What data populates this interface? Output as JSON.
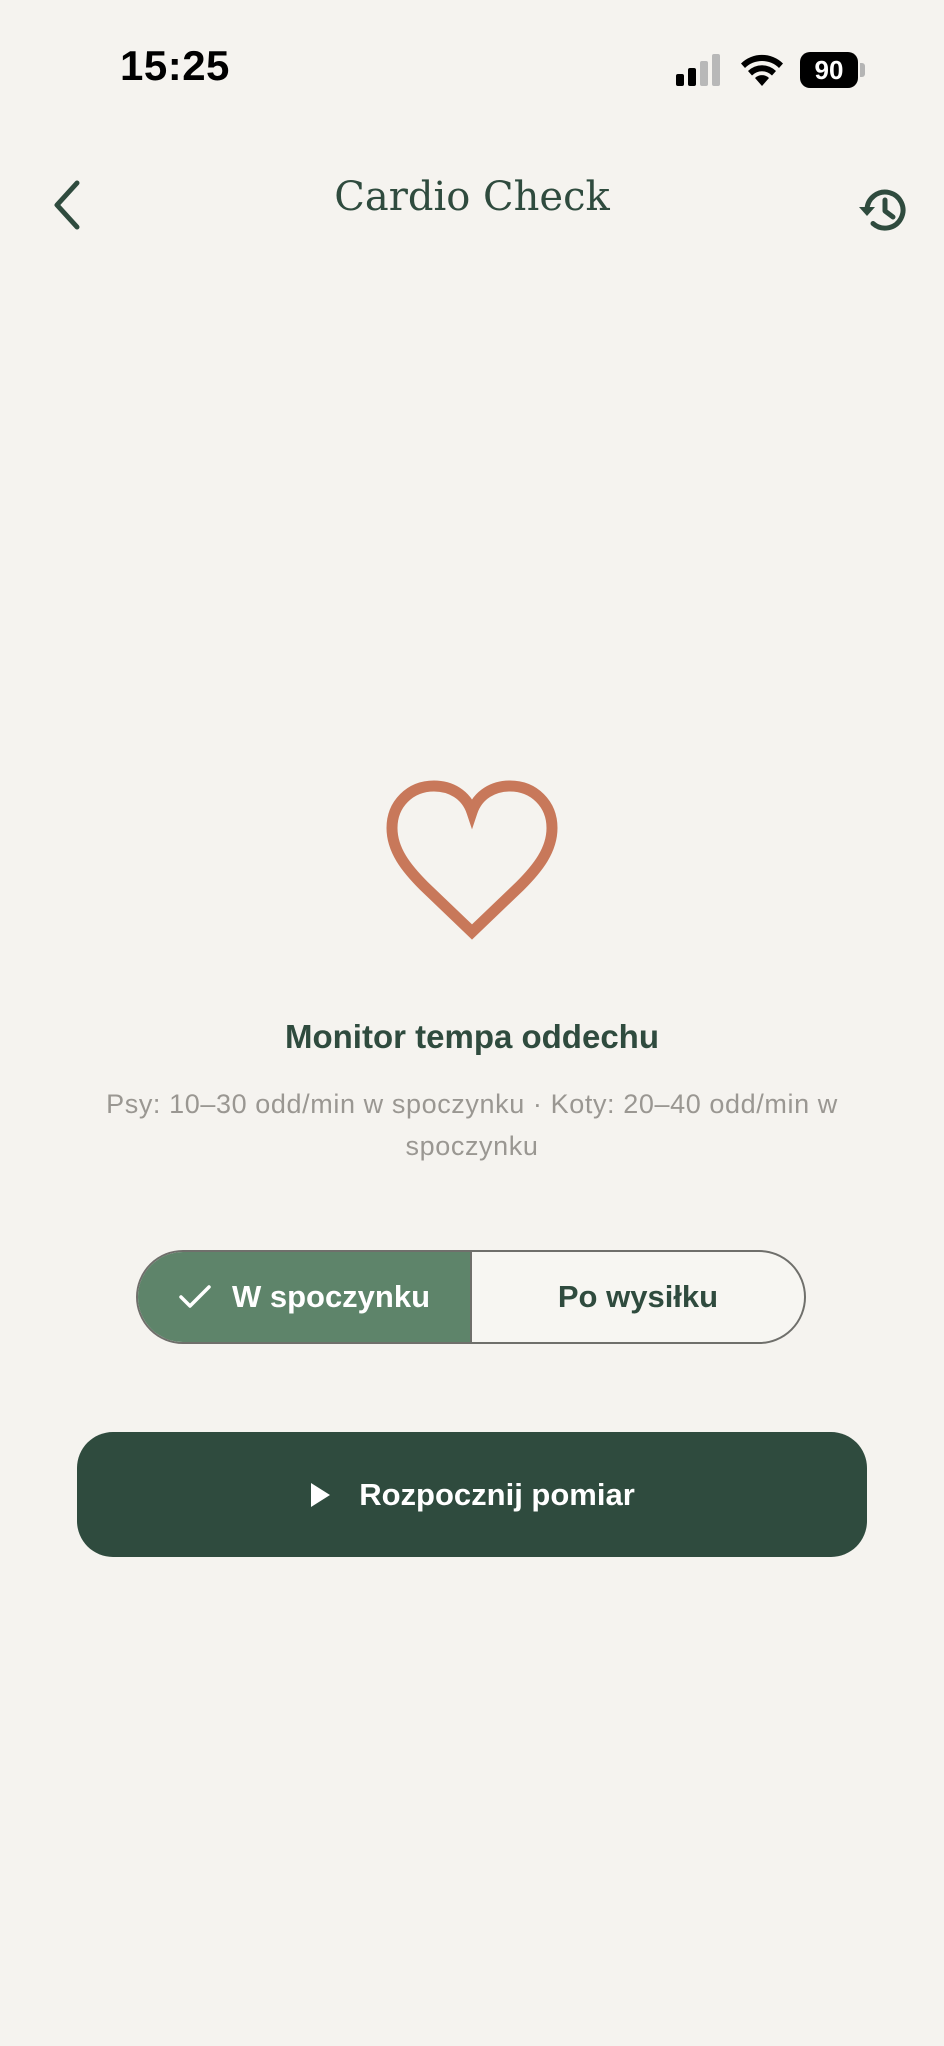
{
  "status_bar": {
    "time": "15:25",
    "battery": "90"
  },
  "nav": {
    "title": "Cardio Check",
    "back_icon": "chevron-left-icon",
    "history_icon": "history-icon"
  },
  "hero": {
    "icon": "heart-outline-icon",
    "icon_color": "#c8785a",
    "title": "Monitor tempa oddechu",
    "subtitle": "Psy: 10–30 odd/min w spoczynku · Koty: 20–40 odd/min w spoczynku"
  },
  "mode_toggle": {
    "options": [
      {
        "label": "W spoczynku",
        "selected": true
      },
      {
        "label": "Po wysiłku",
        "selected": false
      }
    ]
  },
  "start_button": {
    "label": "Rozpocznij pomiar",
    "icon": "play-icon"
  },
  "colors": {
    "background": "#f5f3ef",
    "primary": "#2f4b3e",
    "toggle_active": "#5e846a",
    "accent": "#c8785a"
  }
}
